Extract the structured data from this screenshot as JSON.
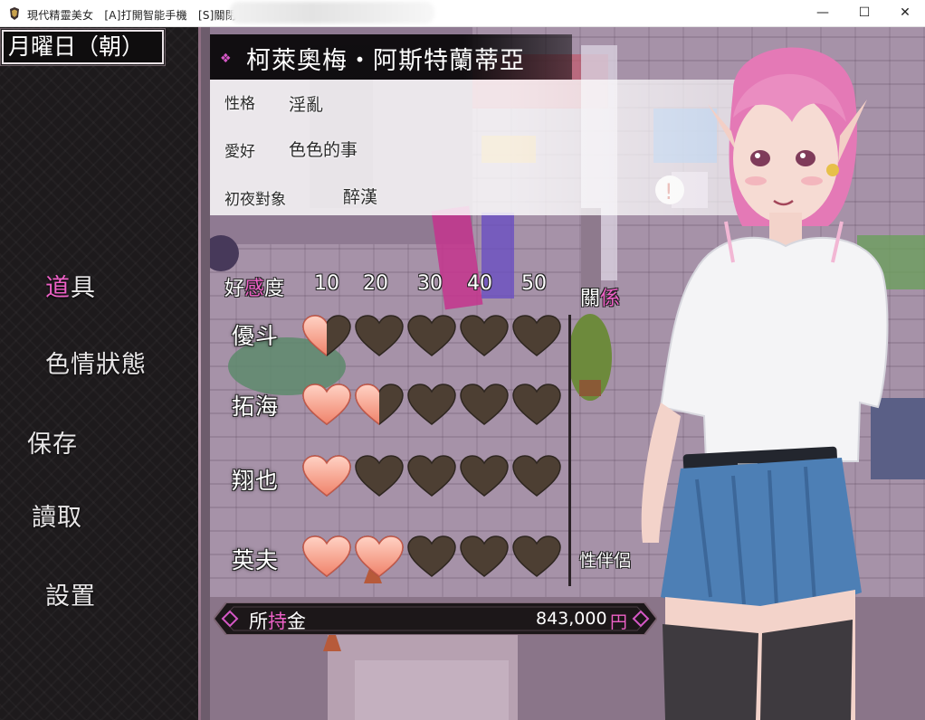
{
  "window": {
    "title": "現代精靈美女　[A]打開智能手機　[S]關閉",
    "min_glyph": "—",
    "max_glyph": "☐",
    "close_glyph": "✕"
  },
  "sidebar": {
    "date": "月曜日（朝）",
    "items": [
      {
        "first": "道",
        "rest": "具",
        "highlight_first": true
      },
      {
        "first": "",
        "rest": "色情狀態",
        "highlight_first": false
      },
      {
        "first": "",
        "rest": "保存",
        "highlight_first": false
      },
      {
        "first": "",
        "rest": "讀取",
        "highlight_first": false
      },
      {
        "first": "",
        "rest": "設置",
        "highlight_first": false
      }
    ]
  },
  "profile": {
    "name": "柯萊奧梅・阿斯特蘭蒂亞",
    "personality_label": "性格",
    "personality_value": "淫亂",
    "hobby_label": "愛好",
    "hobby_value": "色色的事",
    "first_night_label": "初夜對象",
    "first_night_value": "醉漢"
  },
  "affection": {
    "header_a": "好",
    "header_b": "感",
    "header_c": "度",
    "levels": [
      "10",
      "20",
      "30",
      "40",
      "50"
    ],
    "max_hearts": 5,
    "rows": [
      {
        "name": "優斗",
        "hearts": 0.5
      },
      {
        "name": "拓海",
        "hearts": 1.5
      },
      {
        "name": "翔也",
        "hearts": 1
      },
      {
        "name": "英夫",
        "hearts": 2
      }
    ],
    "relation_header_a": "關",
    "relation_header_b": "係",
    "relations": [
      "",
      "",
      "",
      "性伴侶"
    ]
  },
  "money": {
    "label_a": "所",
    "label_b": "持",
    "label_c": "金",
    "amount": "843,000",
    "unit": "円"
  },
  "colors": {
    "accent_pink": "#ee61c7",
    "heart_full": "#f0836b",
    "heart_empty": "#4d3f33",
    "sidebar_bg": "#1d1a1c"
  }
}
